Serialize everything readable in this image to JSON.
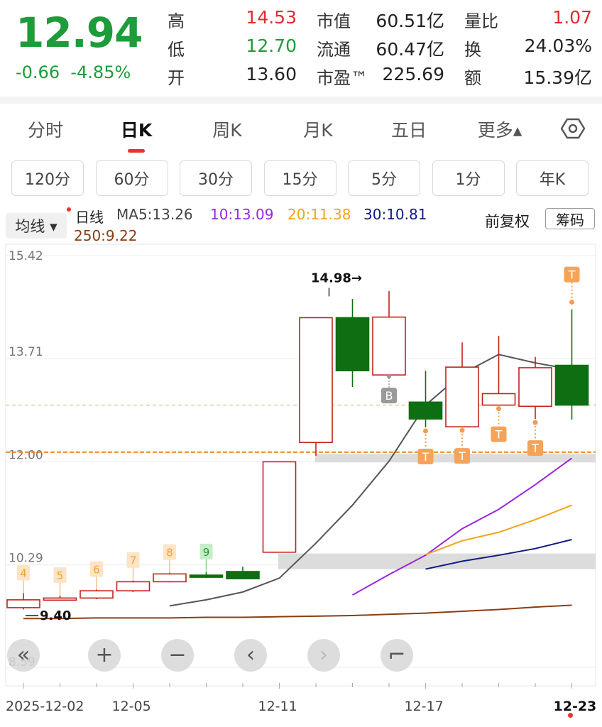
{
  "quote": {
    "price": "12.94",
    "change": "-0.66",
    "change_pct": "-4.85%",
    "rows": [
      {
        "l1": "高",
        "v1": "14.53",
        "l2": "市值",
        "v2": "60.51亿",
        "l3": "量比",
        "v3": "1.07"
      },
      {
        "l1": "低",
        "v1": "12.70",
        "l2": "流通",
        "v2": "60.47亿",
        "l3": "换",
        "v3": "24.03%"
      },
      {
        "l1": "开",
        "v1": "13.60",
        "l2": "市盈™",
        "v2": "225.69",
        "l3": "额",
        "v3": "15.39亿"
      }
    ]
  },
  "tabs": [
    "分时",
    "日K",
    "周K",
    "月K",
    "五日",
    "更多▴"
  ],
  "active_tab": "日K",
  "periods": [
    "120分",
    "60分",
    "30分",
    "15分",
    "5分",
    "1分",
    "年K"
  ],
  "indicator": {
    "selector": "均线 ▾",
    "line_name": "日线",
    "ma5": "MA5:13.26",
    "ma10": "10:13.09",
    "ma20": "20:11.38",
    "ma30": "30:10.81",
    "ma250": "250:9.22",
    "adjust": "前复权",
    "chips": "筹码"
  },
  "colors": {
    "up": "#c2221b",
    "down": "#0e6e12",
    "ma5": "#555555",
    "ma10": "#9a27e0",
    "ma20": "#f0a419",
    "ma30": "#101a80",
    "ma250": "#8a3d12",
    "accent": "#e8342f"
  },
  "chart_data": {
    "type": "candlestick",
    "y_ticks": [
      "15.42",
      "13.71",
      "12.00",
      "10.29",
      "8.59"
    ],
    "ylim": [
      8.59,
      15.42
    ],
    "x_ticks": [
      "2025-12-02",
      "12-05",
      "12-11",
      "12-17",
      "12-23"
    ],
    "max_label": "14.98→",
    "min_label": "9.40",
    "candles": [
      {
        "o": 9.58,
        "c": 9.71,
        "h": 9.82,
        "l": 9.55,
        "mark": "4"
      },
      {
        "o": 9.71,
        "c": 9.74,
        "h": 9.78,
        "l": 9.7,
        "mark": "5"
      },
      {
        "o": 9.74,
        "c": 9.86,
        "h": 9.88,
        "l": 9.72,
        "mark": "6"
      },
      {
        "o": 9.86,
        "c": 10.01,
        "h": 10.03,
        "l": 9.84,
        "mark": "7"
      },
      {
        "o": 10.01,
        "c": 10.14,
        "h": 10.16,
        "l": 10.0,
        "mark": "8"
      },
      {
        "o": 10.12,
        "c": 10.09,
        "h": 10.17,
        "l": 10.07,
        "mark": "9"
      },
      {
        "o": 10.18,
        "c": 10.06,
        "h": 10.26,
        "l": 10.05,
        "mark": ""
      },
      {
        "o": 10.5,
        "c": 12.0,
        "h": 12.0,
        "l": 10.5,
        "mark": ""
      },
      {
        "o": 12.32,
        "c": 14.39,
        "h": 14.39,
        "l": 12.1,
        "mark": ""
      },
      {
        "o": 14.39,
        "c": 13.51,
        "h": 14.7,
        "l": 13.24,
        "mark": ""
      },
      {
        "o": 13.44,
        "c": 14.4,
        "h": 14.83,
        "l": 13.44,
        "mark": "B"
      },
      {
        "o": 12.99,
        "c": 12.71,
        "h": 13.51,
        "l": 12.57,
        "mark": "T"
      },
      {
        "o": 12.58,
        "c": 13.57,
        "h": 13.98,
        "l": 12.58,
        "mark": "T"
      },
      {
        "o": 12.94,
        "c": 13.13,
        "h": 14.09,
        "l": 12.94,
        "mark": "T"
      },
      {
        "o": 12.92,
        "c": 13.56,
        "h": 13.74,
        "l": 12.71,
        "mark": "T"
      },
      {
        "o": 13.6,
        "c": 12.94,
        "h": 14.53,
        "l": 12.7,
        "mark": "T"
      }
    ],
    "series": [
      {
        "name": "MA5",
        "values": [
          null,
          null,
          null,
          null,
          9.61,
          9.71,
          9.84,
          10.07,
          10.65,
          11.28,
          12.01,
          12.94,
          13.46,
          13.78,
          13.64,
          13.53
        ]
      },
      {
        "name": "10",
        "values": [
          null,
          null,
          null,
          null,
          null,
          null,
          null,
          null,
          null,
          9.79,
          10.13,
          10.45,
          10.89,
          11.21,
          11.62,
          12.06
        ]
      },
      {
        "name": "20",
        "values": [
          null,
          null,
          null,
          null,
          null,
          null,
          null,
          null,
          null,
          null,
          null,
          10.46,
          10.69,
          10.83,
          11.04,
          11.28
        ]
      },
      {
        "name": "30",
        "values": [
          null,
          null,
          null,
          null,
          null,
          null,
          null,
          null,
          null,
          null,
          null,
          10.22,
          10.35,
          10.45,
          10.56,
          10.71
        ]
      },
      {
        "name": "250",
        "values": [
          9.4,
          9.4,
          9.41,
          9.41,
          9.41,
          9.42,
          9.42,
          9.43,
          9.44,
          9.45,
          9.47,
          9.49,
          9.52,
          9.55,
          9.59,
          9.62
        ]
      }
    ],
    "hlines": [
      12.94,
      12.16
    ]
  },
  "zoom": [
    "«",
    "+",
    "−",
    "‹",
    "›",
    "⌐"
  ]
}
